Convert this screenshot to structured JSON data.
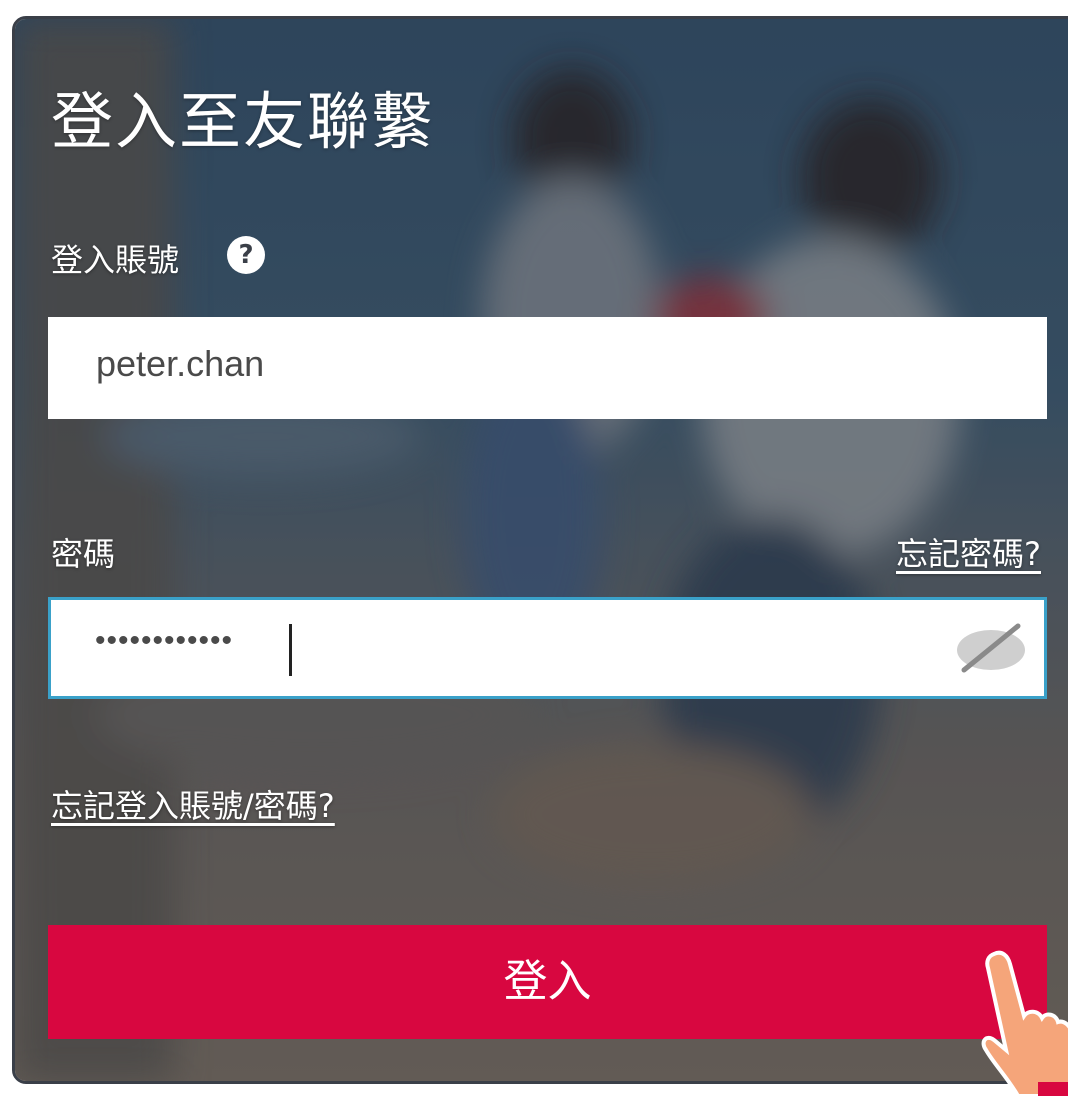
{
  "login": {
    "title": "登入至友聯繫",
    "account_label": "登入賬號",
    "help_symbol": "?",
    "account_value": "peter.chan",
    "password_label": "密碼",
    "forgot_password_link": "忘記密碼?",
    "password_value": "••••••••••••",
    "forgot_both_link": "忘記登入賬號/密碼?",
    "login_button": "登入"
  },
  "icons": {
    "help": "question-circle-icon",
    "visibility": "eye-hidden-icon",
    "pointer": "pointing-hand-icon"
  },
  "colors": {
    "accent_button": "#d80740",
    "input_focus_border": "#3aa1c9",
    "card_border": "#3a3f48"
  }
}
